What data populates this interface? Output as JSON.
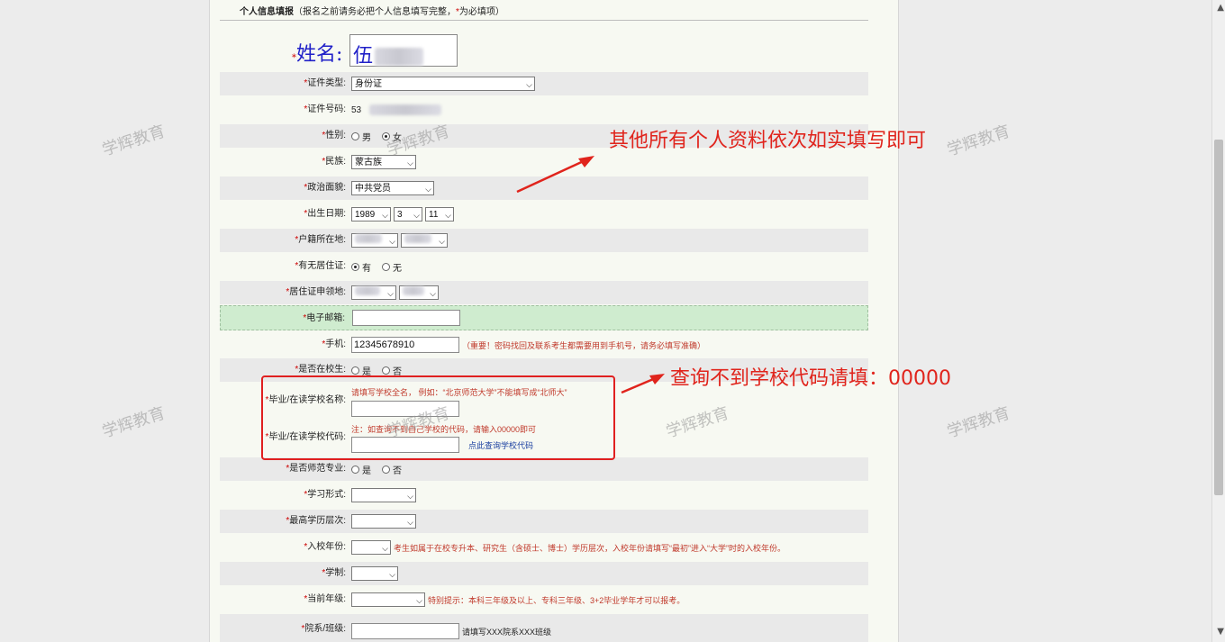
{
  "section": {
    "title": "个人信息填报",
    "note_prefix": "（报名之前请务必把个人信息填写完整，",
    "note_star": "*",
    "note_suffix": "为必填项）"
  },
  "name": {
    "label": "姓名:",
    "value": "伍"
  },
  "fields": {
    "id_type": {
      "label": "证件类型:",
      "value": "身份证"
    },
    "id_number": {
      "label": "证件号码:",
      "value": "53"
    },
    "gender": {
      "label": "性别:",
      "opt_male": "男",
      "opt_female": "女",
      "selected": "女"
    },
    "ethnicity": {
      "label": "民族:",
      "value": "蒙古族"
    },
    "political": {
      "label": "政治面貌:",
      "value": "中共党员"
    },
    "birth": {
      "label": "出生日期:",
      "year": "1989",
      "month": "3",
      "day": "11"
    },
    "hukou": {
      "label": "户籍所在地:"
    },
    "residence_permit": {
      "label": "有无居住证:",
      "opt_yes": "有",
      "opt_no": "无",
      "selected": "有"
    },
    "permit_place": {
      "label": "居住证申领地:"
    },
    "email": {
      "label": "电子邮箱:",
      "value": ""
    },
    "phone": {
      "label": "手机:",
      "value": "12345678910",
      "hint": "（重要！密码找回及联系考生都需要用到手机号，请务必填写准确）"
    },
    "in_school": {
      "label": "是否在校生:",
      "opt_yes": "是",
      "opt_no": "否"
    },
    "school_name": {
      "label": "毕业/在读学校名称:",
      "hint": "请填写学校全名， 例如：“北京师范大学”不能填写成“北师大”"
    },
    "school_code": {
      "label": "毕业/在读学校代码:",
      "hint": "注：如查询不到自己学校的代码，请输入00000即可",
      "link": "点此查询学校代码"
    },
    "normal_major": {
      "label": "是否师范专业:",
      "opt_yes": "是",
      "opt_no": "否"
    },
    "study_form": {
      "label": "学习形式:"
    },
    "edu_level": {
      "label": "最高学历层次:"
    },
    "entry_year": {
      "label": "入校年份:",
      "hint": "考生如属于在校专升本、研究生（含硕士、博士）学历层次，入校年份请填写“最初”进入“大学”时的入校年份。"
    },
    "schooling": {
      "label": "学制:"
    },
    "grade": {
      "label": "当前年级:",
      "hint": "特别提示：本科三年级及以上、专科三年级、3+2毕业学年才可以报考。"
    },
    "dept_class": {
      "label": "院系/班级:",
      "hint": "请填写XXX院系XXX班级"
    }
  },
  "annotations": {
    "top": "其他所有个人资料依次如实填写即可",
    "code": "查询不到学校代码请填：00000"
  },
  "watermark": "学辉教育",
  "colors": {
    "accent": "#e0241c",
    "name_blue": "#2121c8",
    "hint_red": "#c0392b",
    "focus_green": "#cfeccf"
  }
}
